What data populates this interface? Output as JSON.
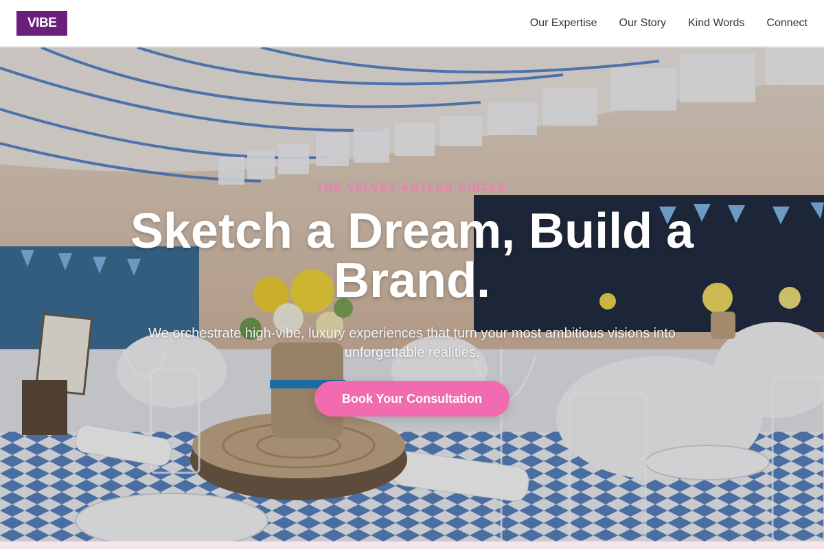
{
  "nav": {
    "logo": "VIBE",
    "links": [
      "Our Expertise",
      "Our Story",
      "Kind Words",
      "Connect"
    ]
  },
  "hero": {
    "eyebrow": "THE VELVET ANTLER CIRCLE",
    "headline": "Sketch a Dream, Build a Brand.",
    "subtext": "We orchestrate high-vibe, luxury experiences that turn your most ambitious visions into unforgettable realities.",
    "cta_label": "Book Your Consultation"
  },
  "colors": {
    "brand_purple": "#6b1f7c",
    "accent_pink": "#f26aaf",
    "eyebrow_pink": "#f07ab5"
  }
}
